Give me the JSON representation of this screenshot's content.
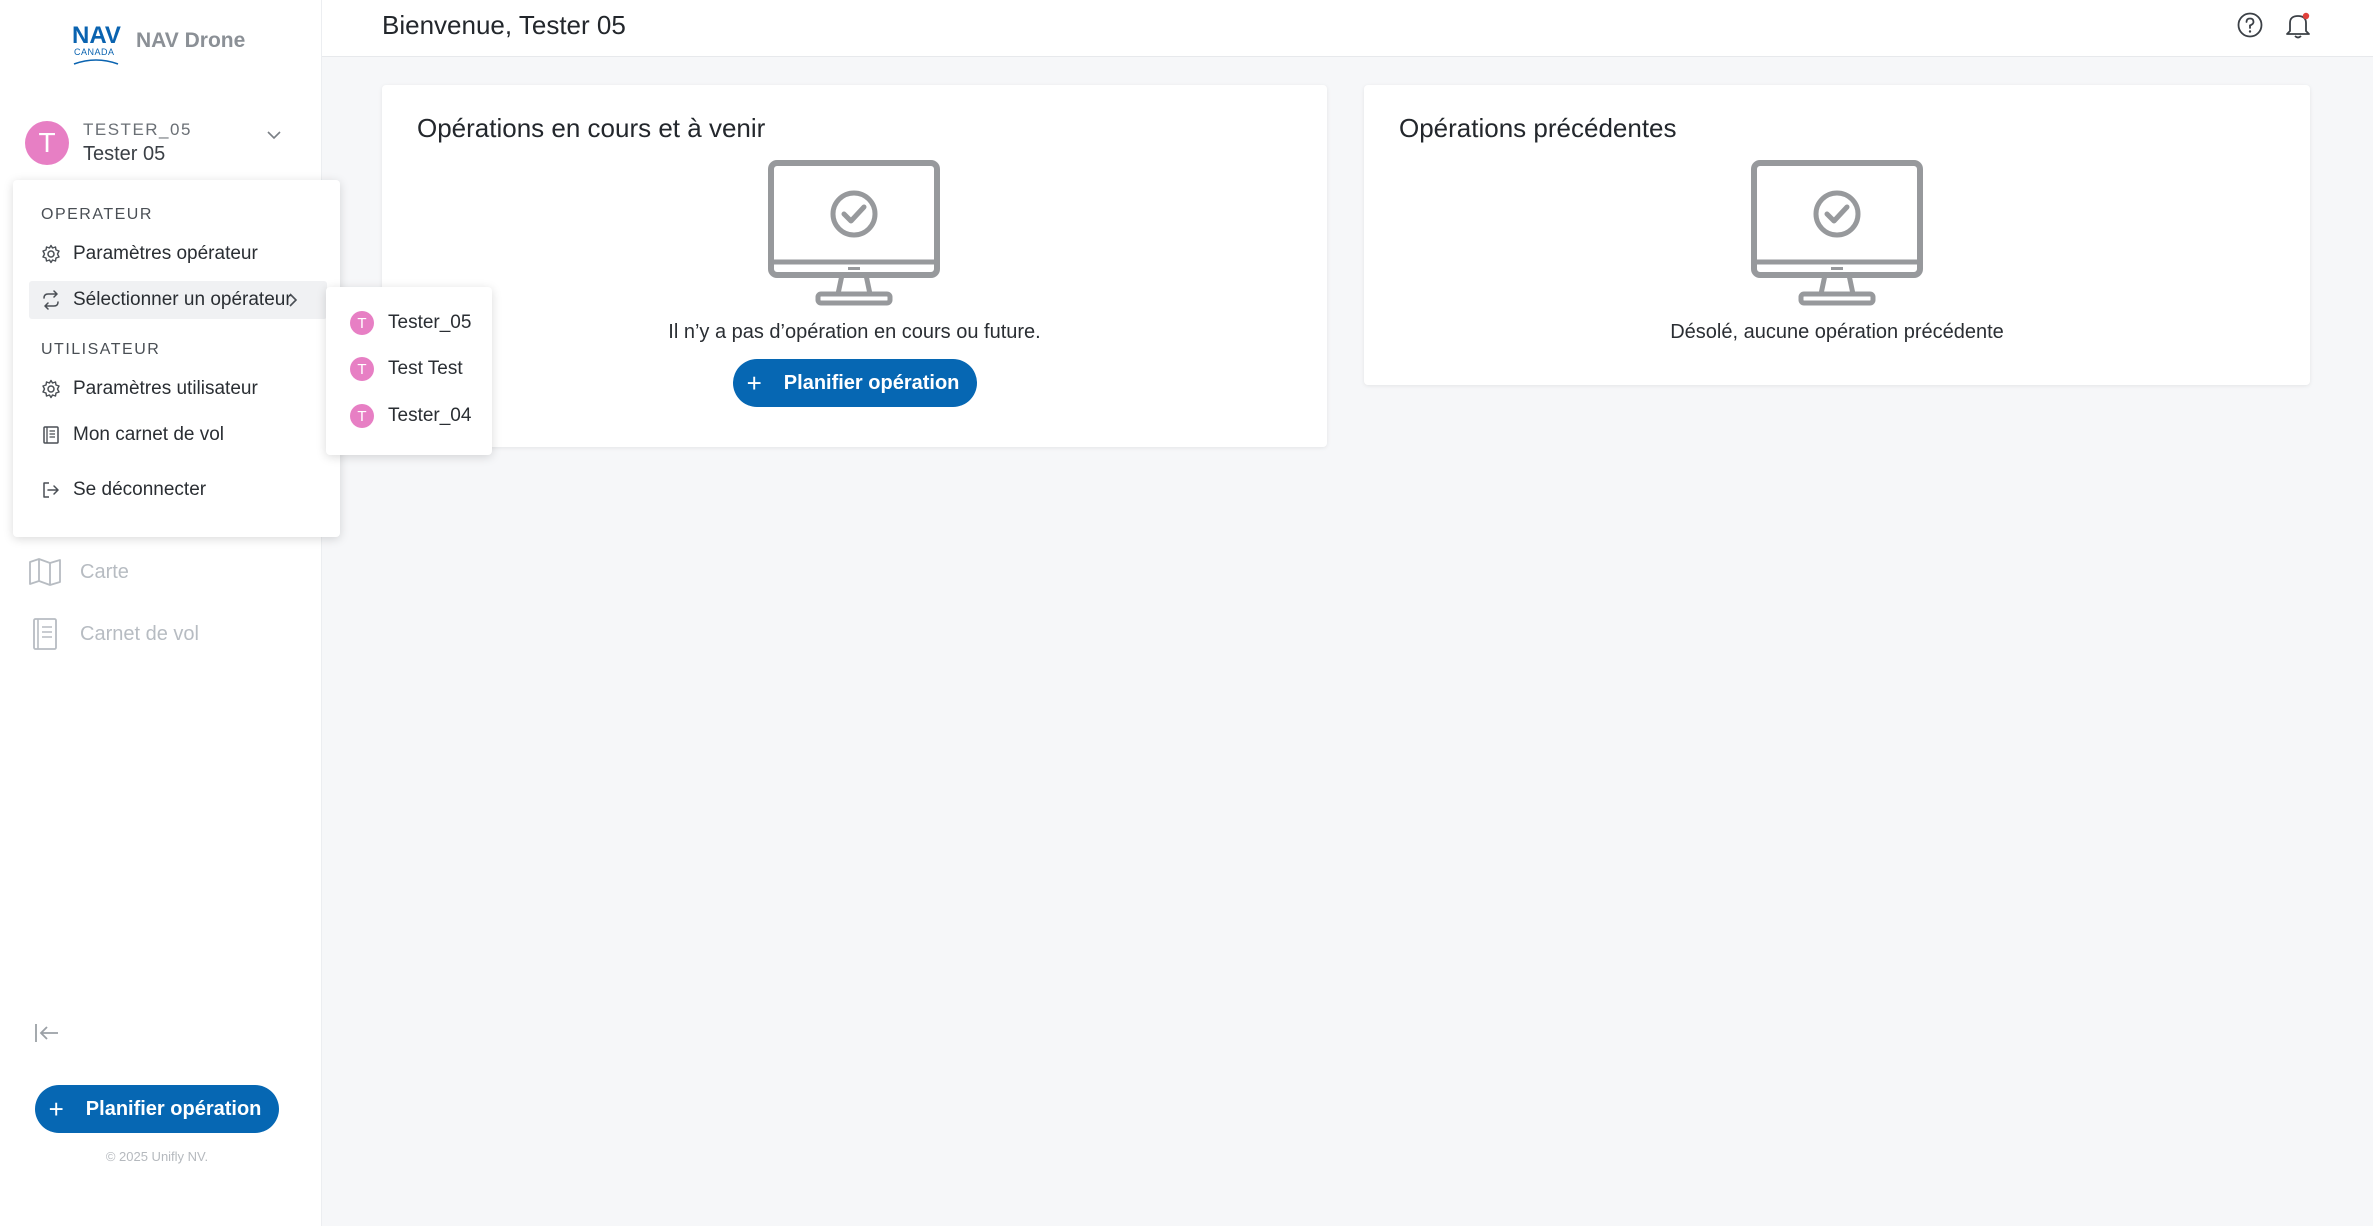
{
  "brand": {
    "logo_text": "NAV",
    "logo_subtext": "CANADA",
    "name": "NAV Drone"
  },
  "user": {
    "initial": "T",
    "handle": "TESTER_05",
    "display_name": "Tester 05",
    "avatar_color": "#e77fc4"
  },
  "sidebar": {
    "nav": [
      {
        "label": "Carte",
        "icon": "map-icon"
      },
      {
        "label": "Carnet de vol",
        "icon": "logbook-icon"
      }
    ],
    "plan_button": "Planifier opération",
    "copyright": "© 2025 Unifly NV."
  },
  "header": {
    "title": "Bienvenue, Tester 05"
  },
  "cards": {
    "current": {
      "title": "Opérations en cours et à venir",
      "message": "Il n’y a pas d’opération en cours ou future.",
      "button": "Planifier opération"
    },
    "past": {
      "title": "Opérations précédentes",
      "message": "Désolé, aucune opération précédente"
    }
  },
  "menu": {
    "section_operator": "OPERATEUR",
    "operator_settings": "Paramètres opérateur",
    "select_operator": "Sélectionner un opérateur",
    "section_user": "UTILISATEUR",
    "user_settings": "Paramètres utilisateur",
    "logbook": "Mon carnet de vol",
    "logout": "Se déconnecter"
  },
  "submenu": {
    "operators": [
      {
        "initial": "T",
        "name": "Tester_05"
      },
      {
        "initial": "T",
        "name": "Test Test"
      },
      {
        "initial": "T",
        "name": "Tester_04"
      }
    ]
  },
  "colors": {
    "primary": "#0667b3",
    "avatar": "#e77fc4",
    "notification_dot": "#e0403a"
  }
}
